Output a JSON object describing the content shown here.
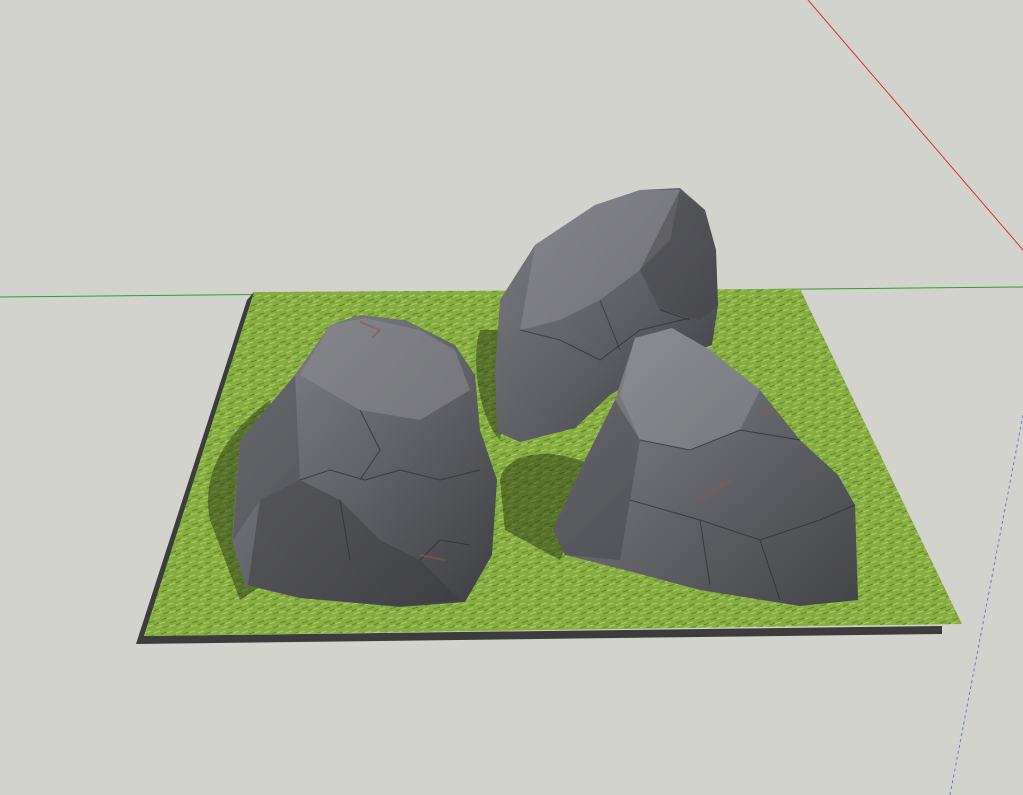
{
  "app": {
    "type": "3d-modeling-viewport",
    "background_color": "#d3d3cd"
  },
  "scene": {
    "objects": [
      {
        "kind": "ground-plane",
        "material": "grass",
        "colors": {
          "light": "#8fb648",
          "dark": "#5f8a2a",
          "edge": "#3c3c3c"
        }
      },
      {
        "kind": "boulder",
        "name": "rock-left",
        "color": "#6a6b70"
      },
      {
        "kind": "boulder",
        "name": "rock-back",
        "color": "#66676c"
      },
      {
        "kind": "boulder",
        "name": "rock-right",
        "color": "#6e6f74"
      }
    ],
    "axes": {
      "green": "#2ea02e",
      "red": "#d83030",
      "blue": "#6a78c8"
    }
  }
}
